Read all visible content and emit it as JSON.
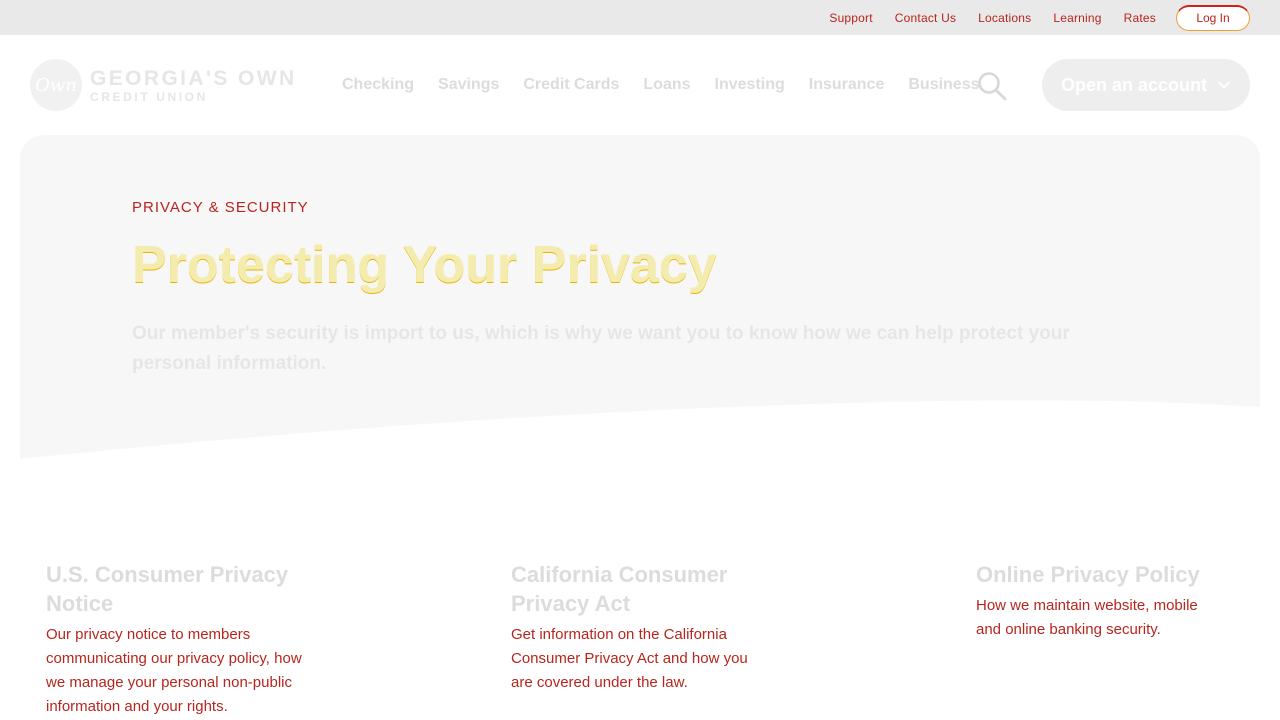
{
  "utility": {
    "links": [
      "Support",
      "Contact Us",
      "Locations",
      "Learning",
      "Rates"
    ],
    "login_label": "Log In"
  },
  "header": {
    "logo_mark": "Own",
    "logo_name": "GEORGIA'S OWN",
    "logo_sub": "CREDIT UNION",
    "nav": [
      "Checking",
      "Savings",
      "Credit Cards",
      "Loans",
      "Investing",
      "Insurance",
      "Business"
    ],
    "search_icon": "search-icon",
    "open_account_label": "Open an account"
  },
  "hero": {
    "eyebrow": "PRIVACY & SECURITY",
    "title": "Protecting Your Privacy",
    "description": "Our member's security is import to us, which is why we want you to know how we can help protect your personal information."
  },
  "cards": [
    {
      "title": "U.S. Consumer Privacy Notice",
      "description": "Our privacy notice to members communicating our privacy policy, how we manage your personal non-public information and your rights."
    },
    {
      "title": "California Consumer Privacy Act",
      "description": "Get information on the California Consumer Privacy Act and how you are covered under the law."
    },
    {
      "title": "Online Privacy Policy",
      "description": "How we maintain website, mobile and online banking security."
    }
  ],
  "colors": {
    "accent_red": "#b7261e",
    "title_yellow": "#f3ecae",
    "hero_bg": "#f7f7f7"
  }
}
